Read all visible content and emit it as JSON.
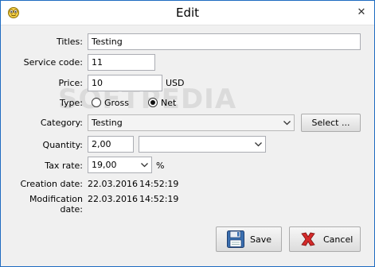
{
  "window": {
    "title": "Edit",
    "close_glyph": "✕"
  },
  "watermark": "SOFTPEDIA",
  "form": {
    "titles": {
      "label": "Titles:",
      "value": "Testing"
    },
    "service_code": {
      "label": "Service code:",
      "value": "11"
    },
    "price": {
      "label": "Price:",
      "value": "10",
      "unit": "USD"
    },
    "type": {
      "label": "Type:",
      "options": [
        "Gross",
        "Net"
      ],
      "selected": "Net"
    },
    "category": {
      "label": "Category:",
      "value": "Testing",
      "select_button": "Select ..."
    },
    "quantity": {
      "label": "Quantity:",
      "value": "2,00",
      "unit_value": ""
    },
    "tax_rate": {
      "label": "Tax rate:",
      "value": "19,00",
      "unit": "%"
    },
    "creation_date": {
      "label": "Creation date:",
      "date": "22.03.2016",
      "time": "14:52:19"
    },
    "modification_date": {
      "label": "Modification date:",
      "date": "22.03.2016",
      "time": "14:52:19"
    }
  },
  "buttons": {
    "save": "Save",
    "cancel": "Cancel"
  },
  "icons": {
    "app": "app-icon",
    "save": "floppy-disk-icon",
    "cancel": "red-x-icon"
  },
  "colors": {
    "window_border": "#1e6bc1",
    "cancel_red": "#d42a2a",
    "floppy_blue": "#3a6fb0"
  }
}
